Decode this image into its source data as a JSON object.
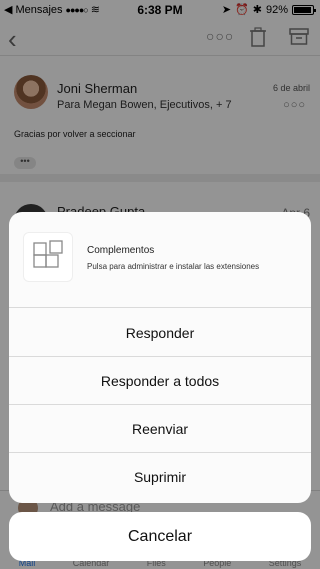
{
  "status_bar": {
    "back_app": "Mensajes",
    "time": "6:38 PM",
    "battery": "92%"
  },
  "thread": {
    "messages": [
      {
        "sender": "Joni Sherman",
        "date": "6 de abril",
        "recipients": "Para Megan Bowen, Ejecutivos, + 7",
        "body": "Gracias por volver a seccionar",
        "expand_label": "•••"
      },
      {
        "sender": "Pradeep Gupta",
        "date": "Apr 6"
      }
    ],
    "compose_placeholder": "Add a message"
  },
  "tabs": [
    "Mail",
    "Calendar",
    "Files",
    "People",
    "Settings"
  ],
  "action_sheet": {
    "addins_title": "Complementos",
    "addins_subtitle": "Pulsa para administrar e instalar las extensiones",
    "actions": [
      "Responder",
      "Responder a todos",
      "Reenviar",
      "Suprimir"
    ],
    "cancel": "Cancelar"
  },
  "icons": [
    "back-chevron-icon",
    "more-icon",
    "trash-icon",
    "archive-icon",
    "wifi-icon",
    "bluetooth-icon",
    "addins-grid-icon"
  ]
}
